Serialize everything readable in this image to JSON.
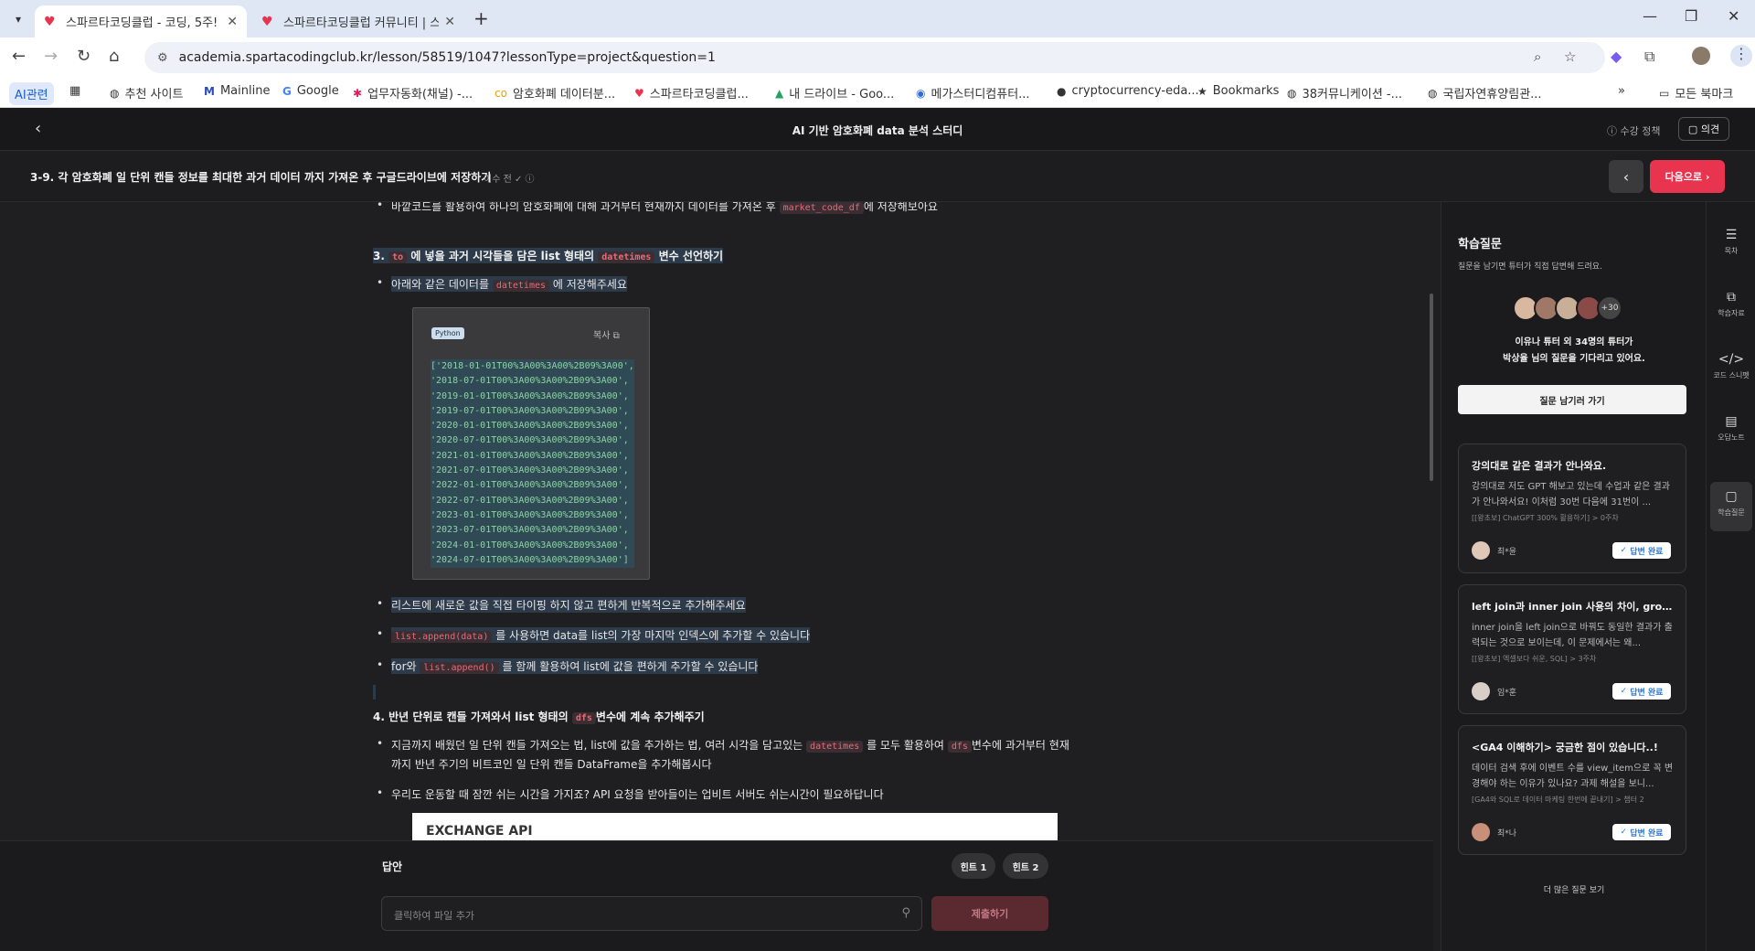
{
  "browser": {
    "tabs": [
      {
        "title": "스파르타코딩클럽 - 코딩, 5주!",
        "active": true
      },
      {
        "title": "스파르타코딩클럽 커뮤니티 | 스",
        "active": false
      }
    ],
    "url": "academia.spartacodingclub.kr/lesson/58519/1047?lessonType=project&question=1",
    "bookmarks": [
      "AI관련",
      "추천 사이트",
      "Mainline",
      "Google",
      "업무자동화(채널) -...",
      "암호화폐 데이터분...",
      "스파르타코딩클럽...",
      "내 드라이브 - Goo...",
      "메가스터디컴퓨터...",
      "cryptocurrency-eda...",
      "Bookmarks",
      "38커뮤니케이션 -...",
      "국립자연휴양림관..."
    ],
    "all_bookmarks": "모든 북마크"
  },
  "header": {
    "title": "AI 기반 암호화폐 data 분석 스터디",
    "policy": "수강 정책",
    "opinion": "의견"
  },
  "lesson": {
    "title": "3-9. 각 암호화폐 일 단위 캔들 정보를 최대한 과거 데이터 까지 가져온 후 구글드라이브에 저장하기",
    "status": "이수 전",
    "next": "다음으로"
  },
  "content": {
    "top_line_pre": "바깥코드를 활용하여 하나의 암호화폐에 대해 과거부터 현재까지 데이터를 가져온 후",
    "top_line_code": "market_code_df",
    "top_line_post": "에 저장해보아요",
    "h3_num": "3.",
    "h3_code1": "to",
    "h3_mid": "에 넣을 과거 시각들을 담은 list 형태의",
    "h3_code2": "datetimes",
    "h3_post": "변수 선언하기",
    "b1_pre": "아래와 같은 데이터를",
    "b1_code": "datetimes",
    "b1_post": "에 저장해주세요",
    "code_lang": "Python",
    "code_copy": "복사",
    "code_lines": [
      "['2018-01-01T00%3A00%3A00%2B09%3A00',",
      " '2018-07-01T00%3A00%3A00%2B09%3A00',",
      " '2019-01-01T00%3A00%3A00%2B09%3A00',",
      " '2019-07-01T00%3A00%3A00%2B09%3A00',",
      " '2020-01-01T00%3A00%3A00%2B09%3A00',",
      " '2020-07-01T00%3A00%3A00%2B09%3A00',",
      " '2021-01-01T00%3A00%3A00%2B09%3A00',",
      " '2021-07-01T00%3A00%3A00%2B09%3A00',",
      " '2022-01-01T00%3A00%3A00%2B09%3A00',",
      " '2022-07-01T00%3A00%3A00%2B09%3A00',",
      " '2023-01-01T00%3A00%3A00%2B09%3A00',",
      " '2023-07-01T00%3A00%3A00%2B09%3A00',",
      " '2024-01-01T00%3A00%3A00%2B09%3A00',",
      " '2024-07-01T00%3A00%3A00%2B09%3A00']"
    ],
    "b2": "리스트에 새로운 값을 직접 타이핑 하지 않고 편하게 반복적으로 추가해주세요",
    "b3_code": "list.append(data)",
    "b3_post": "를 사용하면 data를 list의 가장 마지막 인덱스에 추가할 수 있습니다",
    "b4_pre": "for와",
    "b4_code": "list.append()",
    "b4_post": "를 함께 활용하여 list에 값을 편하게 추가할 수 있습니다",
    "h4_pre": "4. 반년 단위로 캔들 가져와서 list 형태의",
    "h4_code": "dfs",
    "h4_post": "변수에 계속 추가해주기",
    "b5_l1_pre": "지금까지 배웠던 일 단위 캔들 가져오는 법, list에 값을 추가하는 법, 여러 시각을 담고있는",
    "b5_code1": "datetimes",
    "b5_l1_mid": "를 모두 활용하여",
    "b5_code2": "dfs",
    "b5_l1_post": "변수에 과거부터 현재",
    "b5_l2": "까지 반년 주기의 비트코인 일 단위 캔들 DataFrame을 추가해봅시다",
    "b6": "우리도 운동할 때 잠깐 쉬는 시간을 가지죠? API 요청을 받아들이는 업비트 서버도 쉬는시간이 필요하답니다",
    "image_title": "EXCHANGE API"
  },
  "answer": {
    "label": "답안",
    "hint1": "힌트 1",
    "hint2": "힌트 2",
    "placeholder": "클릭하여 파일 추가",
    "submit": "제출하기"
  },
  "questions_panel": {
    "title": "학습질문",
    "subtitle": "질문을 남기면 튜터가 직접 답변해 드려요.",
    "more_count": "+30",
    "wait_line1": "이유나 튜터 외 34명의 튜터가",
    "wait_line2": "박상율 님의 질문을 기다리고 있어요.",
    "ask_button": "질문 남기러 가기",
    "cards": [
      {
        "title": "강의대로 같은 결과가 안나와요.",
        "body": "강의대로 저도 GPT 해보고 있는데 수업과 같은 결과가 안나와서요! 이처럼 30번 다음에 31번이 ...",
        "course": "[[왕초보] ChatGPT 300% 활용하기] > 0주차",
        "author": "최*윤",
        "status": "답변 완료"
      },
      {
        "title": "left join과 inner join 사용의 차이, group...",
        "body": "inner join을 left join으로 바꿔도 동일한 결과가 출력되는 것으로 보이는데, 이 문제에서는 왜...",
        "course": "[[왕초보] 엑셀보다 쉬운, SQL] > 3주차",
        "author": "임*훈",
        "status": "답변 완료"
      },
      {
        "title": "<GA4 이해하기> 궁금한 점이 있습니다..!",
        "body": "데이터 검색 후에 이벤트 수를 view_item으로 꼭 변경해야 하는 이유가 있나요? 과제 해설을 보니...",
        "course": "[GA4와 SQL로 데이터 마케팅 한번에 끝내기] > 챕터 2",
        "author": "최*나",
        "status": "답변 완료"
      }
    ],
    "more": "더 많은 질문 보기"
  },
  "rail": [
    {
      "label": "목차",
      "icon": "list-icon"
    },
    {
      "label": "학습자료",
      "icon": "copy-icon"
    },
    {
      "label": "코드 스니펫",
      "icon": "code-icon"
    },
    {
      "label": "오답노트",
      "icon": "note-icon"
    },
    {
      "label": "학습질문",
      "icon": "question-icon"
    }
  ]
}
